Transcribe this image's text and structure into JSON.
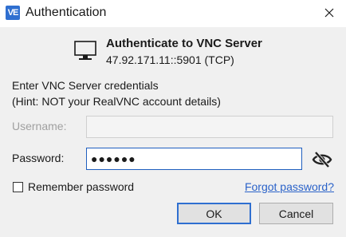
{
  "window": {
    "title": "Authentication",
    "app_icon_text": "VE"
  },
  "header": {
    "title": "Authenticate to VNC Server",
    "server": "47.92.171.11::5901 (TCP)"
  },
  "prompt": {
    "line1": "Enter VNC Server credentials",
    "line2": "(Hint: NOT your RealVNC account details)"
  },
  "form": {
    "username_label": "Username:",
    "username_value": "",
    "password_label": "Password:",
    "password_value": "●●●●●●"
  },
  "options": {
    "remember_label": "Remember password",
    "forgot_link": "Forgot password?"
  },
  "buttons": {
    "ok": "OK",
    "cancel": "Cancel"
  },
  "colors": {
    "accent": "#2f6fd0",
    "link": "#2a62c9",
    "background": "#f0f0f0"
  }
}
